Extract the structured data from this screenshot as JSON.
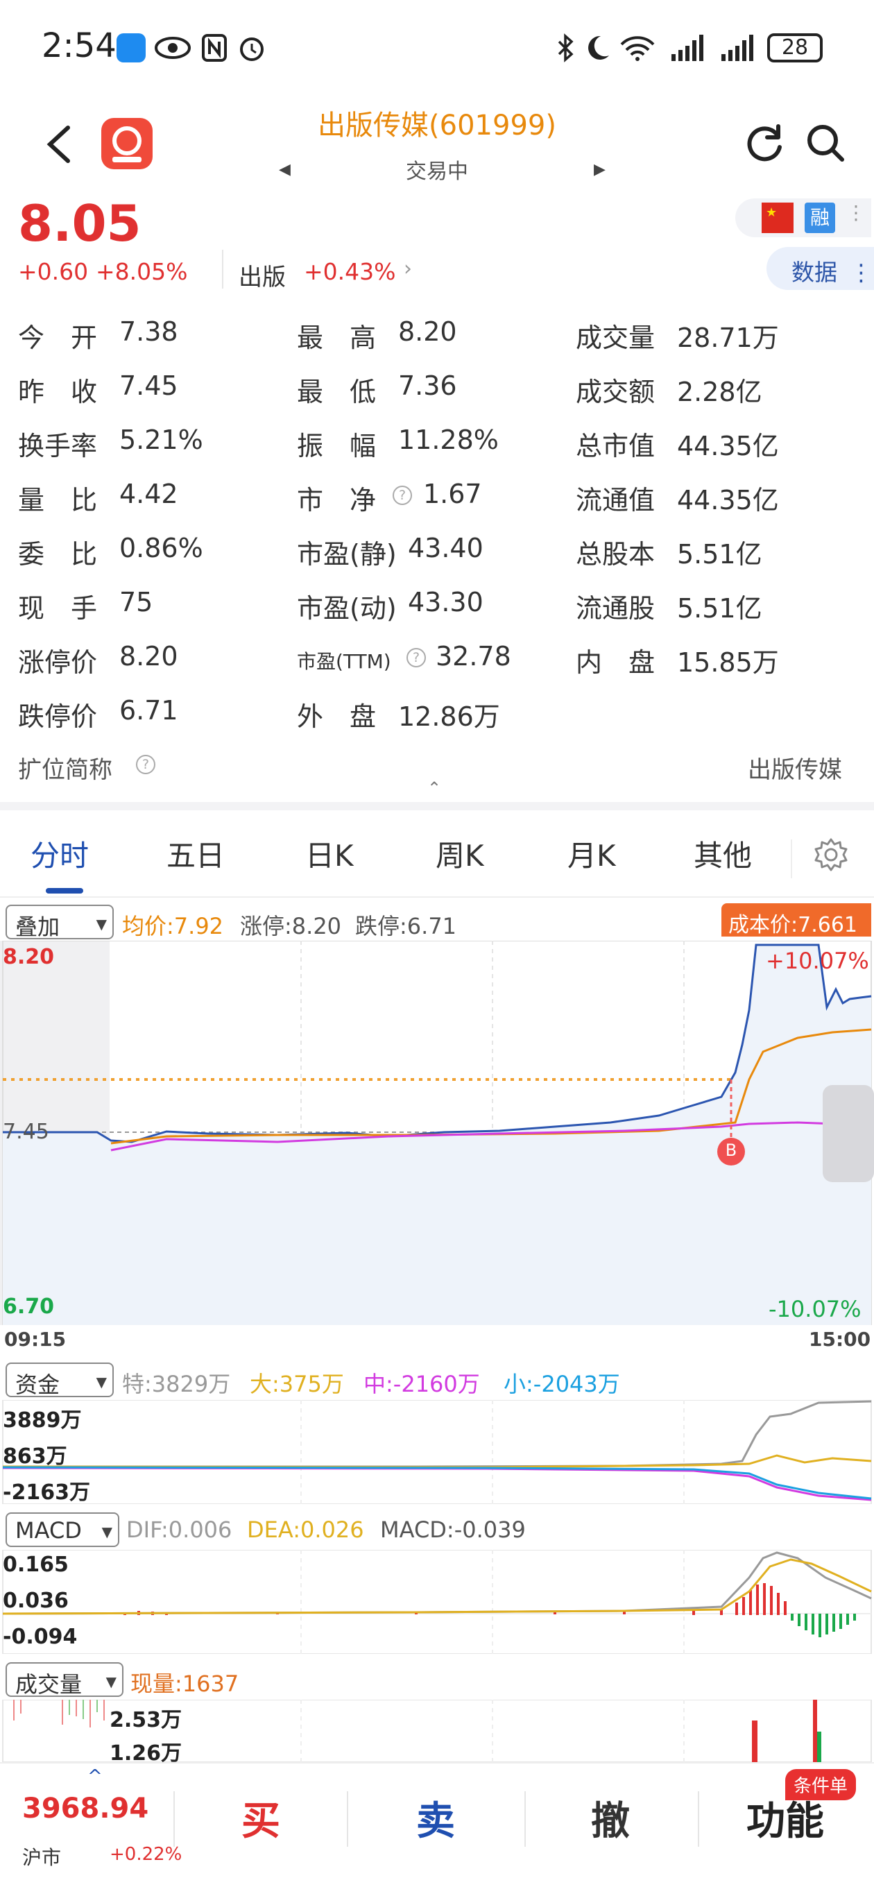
{
  "status": {
    "time": "2:54",
    "battery": "28"
  },
  "header": {
    "title": "出版传媒(601999)",
    "subtitle": "交易中"
  },
  "quote": {
    "price": "8.05",
    "change": "+0.60",
    "change_pct": "+8.05%",
    "sector_name": "出版",
    "sector_pct": "+0.43%",
    "flag_badge": "融",
    "data_button": "数据"
  },
  "stats": {
    "col1": [
      {
        "label": "今　开",
        "value": "7.38"
      },
      {
        "label": "昨　收",
        "value": "7.45"
      },
      {
        "label": "换手率",
        "value": "5.21%"
      },
      {
        "label": "量　比",
        "value": "4.42"
      },
      {
        "label": "委　比",
        "value": "0.86%"
      },
      {
        "label": "现　手",
        "value": "75"
      },
      {
        "label": "涨停价",
        "value": "8.20"
      },
      {
        "label": "跌停价",
        "value": "6.71"
      }
    ],
    "col2": [
      {
        "label": "最　高",
        "value": "8.20"
      },
      {
        "label": "最　低",
        "value": "7.36"
      },
      {
        "label": "振　幅",
        "value": "11.28%"
      },
      {
        "label": "市　净",
        "value": "1.67"
      },
      {
        "label": "市盈(静)",
        "value": "43.40"
      },
      {
        "label": "市盈(动)",
        "value": "43.30"
      },
      {
        "label": "市盈(TTM)",
        "value": "32.78"
      },
      {
        "label": "外　盘",
        "value": "12.86万"
      }
    ],
    "col3": [
      {
        "label": "成交量",
        "value": "28.71万"
      },
      {
        "label": "成交额",
        "value": "2.28亿"
      },
      {
        "label": "总市值",
        "value": "44.35亿"
      },
      {
        "label": "流通值",
        "value": "44.35亿"
      },
      {
        "label": "总股本",
        "value": "5.51亿"
      },
      {
        "label": "流通股",
        "value": "5.51亿"
      },
      {
        "label": "内　盘",
        "value": "15.85万"
      }
    ],
    "ext_label": "扩位简称",
    "ext_value": "出版传媒"
  },
  "tabs": [
    "分时",
    "五日",
    "日K",
    "周K",
    "月K",
    "其他"
  ],
  "chart": {
    "overlay_label": "叠加",
    "avg_label": "均价:7.92",
    "limit_up_label": "涨停:8.20",
    "limit_down_label": "跌停:6.71",
    "cost_label": "成本价:7.661",
    "y_top": "8.20",
    "y_mid": "7.45",
    "y_bottom": "6.70",
    "pct_top": "+10.07%",
    "pct_bottom": "-10.07%",
    "time_start": "09:15",
    "time_end": "15:00",
    "buy_marker": "B"
  },
  "fund": {
    "select_label": "资金",
    "special": "特:3829万",
    "large": "大:375万",
    "medium": "中:-2160万",
    "small": "小:-2043万",
    "y_top": "3889万",
    "y_mid": "863万",
    "y_bottom": "-2163万"
  },
  "macd": {
    "select_label": "MACD",
    "dif": "DIF:0.006",
    "dea": "DEA:0.026",
    "macd": "MACD:-0.039",
    "y_top": "0.165",
    "y_mid": "0.036",
    "y_bottom": "-0.094"
  },
  "volume": {
    "select_label": "成交量",
    "current": "现量:1637",
    "y_top": "2.53万",
    "y_mid": "1.26万"
  },
  "bottom": {
    "index_value": "3968.94",
    "index_name": "沪市",
    "index_pct": "+0.22%",
    "buy": "买",
    "sell": "卖",
    "cancel": "撤",
    "func": "功能",
    "cond_badge": "条件单"
  },
  "colors": {
    "up": "#e03030",
    "down": "#1aa84a",
    "price_line": "#2b55b0",
    "avg_line": "#e8890c",
    "accent": "#1f4fb0"
  },
  "chart_data": [
    {
      "type": "line",
      "title": "",
      "x": [
        "09:15",
        "15:00"
      ],
      "ylim": [
        6.7,
        8.2
      ],
      "series": [
        {
          "values": [
            7.45,
            7.4,
            7.43,
            7.44,
            7.43,
            7.44,
            7.45,
            7.47,
            7.52,
            7.6,
            8.2,
            8.05
          ]
        },
        {
          "name": "均价",
          "values": [
            7.45,
            7.43,
            7.43,
            7.43,
            7.44,
            7.44,
            7.44,
            7.45,
            7.46,
            7.5,
            7.8,
            7.92
          ]
        }
      ],
      "reference": {
        "prev_close": 7.45,
        "cost": 7.661
      }
    }
  ]
}
